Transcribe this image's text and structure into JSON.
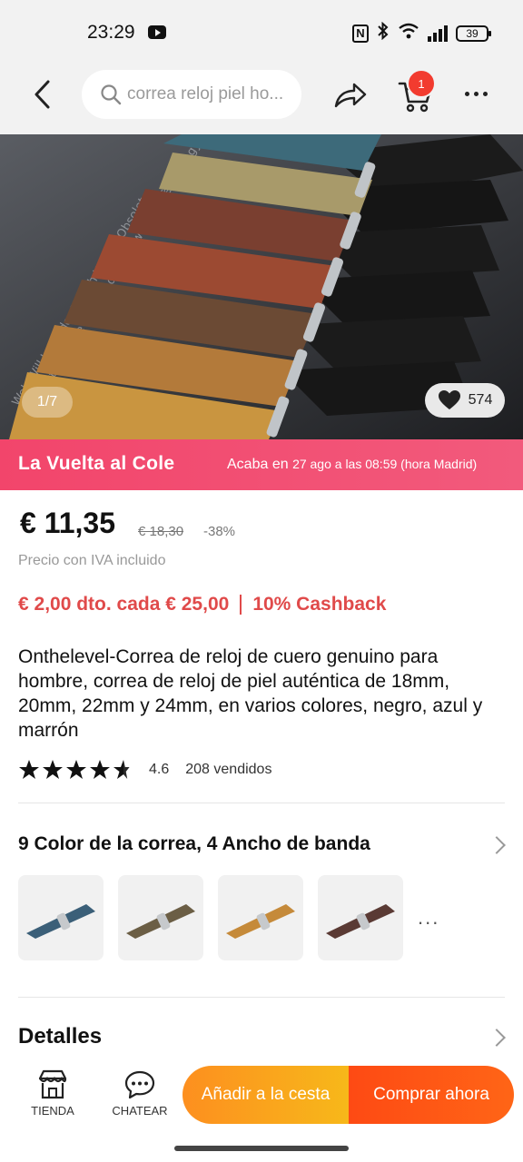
{
  "status_bar": {
    "time": "23:29",
    "battery": "39",
    "nfc": "N"
  },
  "header": {
    "search_placeholder": "correa reloj piel ho...",
    "cart_count": "1"
  },
  "gallery": {
    "counter": "1/7",
    "wishlist_count": "574"
  },
  "promo": {
    "title": "La Vuelta al Cole",
    "ends_prefix": "Acaba en",
    "ends_date": "27 ago a las 08:59 (hora Madrid)"
  },
  "price": {
    "current": "€ 11,35",
    "original": "€ 18,30",
    "discount": "-38%",
    "vat_note": "Precio con IVA incluido"
  },
  "coupon": {
    "discount": "€ 2,00 dto. cada € 25,00",
    "cashback": "10% Cashback"
  },
  "product": {
    "title": "Onthelevel-Correa de reloj de cuero genuino para hombre, correa de reloj de piel auténtica de 18mm, 20mm, 22mm y 24mm, en varios colores, negro, azul y marrón",
    "rating": "4.6",
    "rating_value": 4.6,
    "sold": "208 vendidos"
  },
  "variants": {
    "title": "9 Color de la correa, 4 Ancho de banda",
    "thumbnails": [
      {
        "name": "blue",
        "color": "#3b5f78"
      },
      {
        "name": "olive",
        "color": "#6b5e45"
      },
      {
        "name": "mustard",
        "color": "#c58a3a"
      },
      {
        "name": "brown",
        "color": "#5a3a34"
      }
    ],
    "more": "..."
  },
  "details": {
    "title": "Detalles"
  },
  "bottom_bar": {
    "store_label": "TIENDA",
    "chat_label": "CHATEAR",
    "add_to_cart": "Añadir a la cesta",
    "buy_now": "Comprar ahora"
  },
  "colors": {
    "promo": "#f2456b",
    "coupon": "#e04a4a",
    "add_cart": "#fd8f1f",
    "buy_now": "#fe4a14"
  }
}
